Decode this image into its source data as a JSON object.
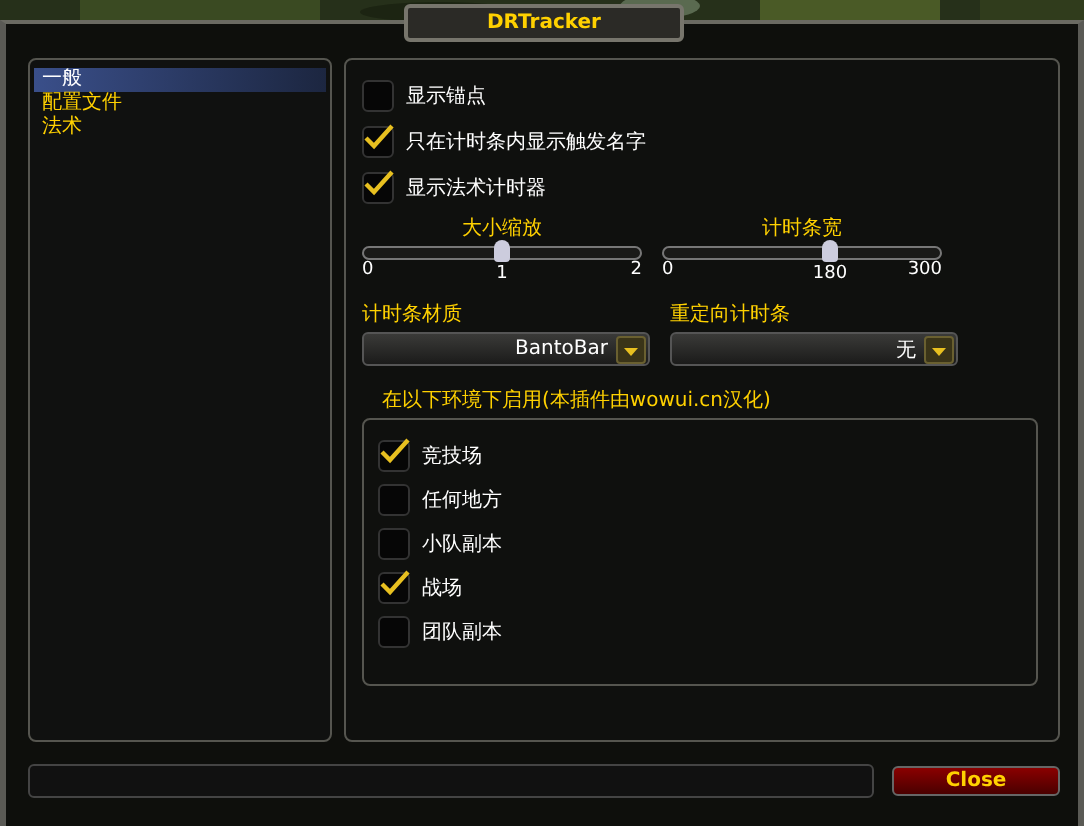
{
  "window": {
    "title": "DRTracker"
  },
  "sidebar": {
    "items": [
      {
        "label": "一般",
        "selected": true
      },
      {
        "label": "配置文件",
        "selected": false
      },
      {
        "label": "法术",
        "selected": false
      }
    ]
  },
  "options": [
    {
      "label": "显示锚点",
      "checked": false
    },
    {
      "label": "只在计时条内显示触发名字",
      "checked": true
    },
    {
      "label": "显示法术计时器",
      "checked": true
    }
  ],
  "sliders": [
    {
      "label": "大小缩放",
      "min": "0",
      "max": "2",
      "value": "1",
      "level": 0.5
    },
    {
      "label": "计时条宽",
      "min": "0",
      "max": "300",
      "value": "180",
      "level": 0.6
    }
  ],
  "dropdowns": [
    {
      "label": "计时条材质",
      "value": "BantoBar"
    },
    {
      "label": "重定向计时条",
      "value": "无"
    }
  ],
  "enable_group": {
    "title": "在以下环境下启用(本插件由wowui.cn汉化)",
    "items": [
      {
        "label": "竞技场",
        "checked": true
      },
      {
        "label": "任何地方",
        "checked": false
      },
      {
        "label": "小队副本",
        "checked": false
      },
      {
        "label": "战场",
        "checked": true
      },
      {
        "label": "团队副本",
        "checked": false
      }
    ]
  },
  "buttons": [
    "Close"
  ]
}
